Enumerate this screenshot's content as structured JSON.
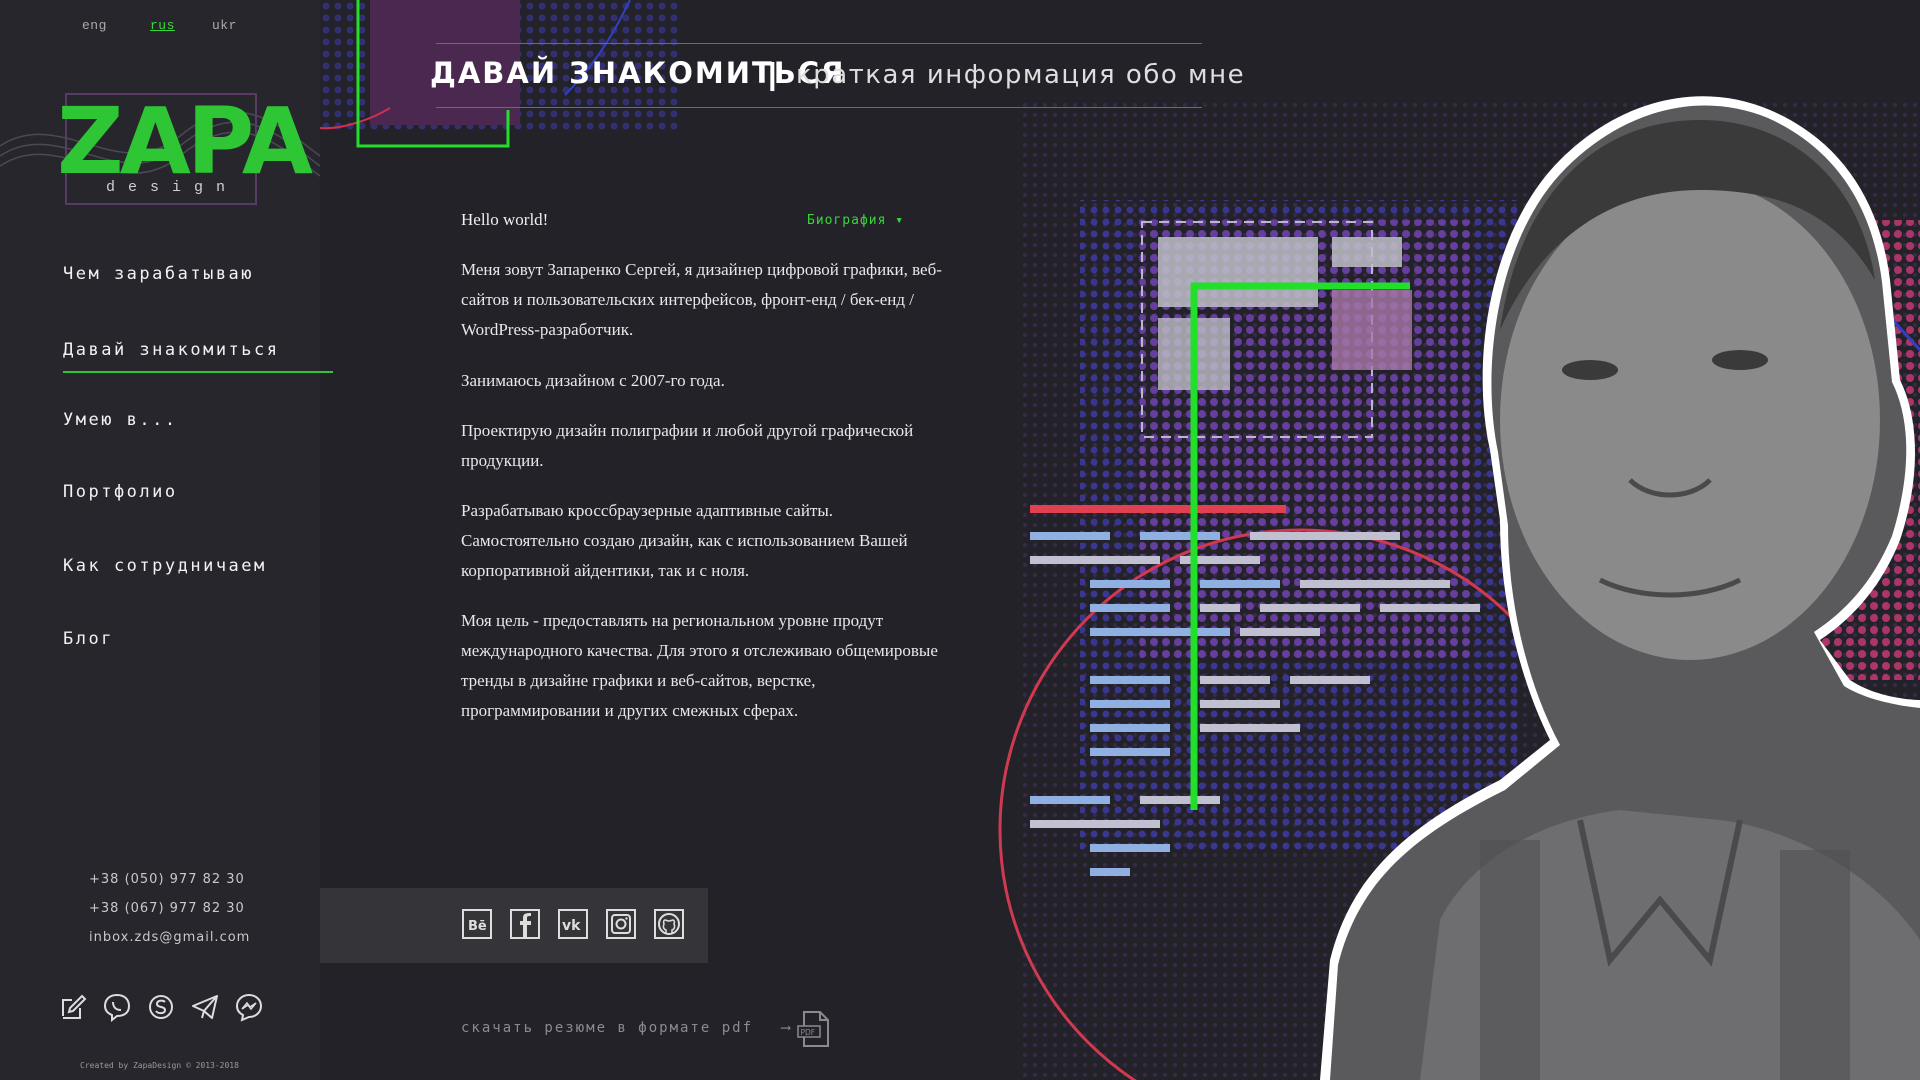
{
  "languages": [
    {
      "code": "eng",
      "active": false
    },
    {
      "code": "rus",
      "active": true
    },
    {
      "code": "ukr",
      "active": false
    }
  ],
  "logo": {
    "main": "ZAPA",
    "sub": "design"
  },
  "nav": [
    {
      "label": "Чем зарабатываю",
      "active": false
    },
    {
      "label": "Давай знакомиться",
      "active": true
    },
    {
      "label": "Умею в...",
      "active": false
    },
    {
      "label": "Портфолио",
      "active": false
    },
    {
      "label": "Как сотрудничаем",
      "active": false
    },
    {
      "label": "Блог",
      "active": false
    }
  ],
  "contacts": {
    "phone1": "+38 (050) 977 82 30",
    "phone2": "+38 (067) 977 82 30",
    "email": "inbox.zds@gmail.com"
  },
  "messengers": [
    "write-icon",
    "viber-icon",
    "skype-icon",
    "telegram-icon",
    "messenger-icon"
  ],
  "credits": "Created by ZapaDesign © 2013-2018",
  "header": {
    "title": "ДАВАЙ ЗНАКОМИТЬСЯ",
    "separator": "|",
    "subtitle": "краткая информация обо мне"
  },
  "content": {
    "hello": "Hello world!",
    "dropdown": "Биография ▾",
    "paragraphs": [
      "Меня зовут Запаренко Сергей, я дизайнер цифровой графики, веб-сайтов и пользовательских интерфейсов, фронт-енд / бек-енд / WordPress-разработчик.",
      "Занимаюсь дизайном с 2007-го года.",
      "Проектирую дизайн полиграфии и любой другой графической продукции.",
      "Разрабатываю кроссбраузерные адаптивные сайты. Самостоятельно создаю дизайн, как с использованием Вашей корпоративной айдентики, так и с ноля.",
      "Моя цель - предоставлять на региональном уровне продут международного качества. Для этого я отслеживаю общемировые тренды в дизайне графики и веб-сайтов, верстке, программировании и других смежных сферах."
    ]
  },
  "social": [
    "behance-icon",
    "facebook-icon",
    "vk-icon",
    "instagram-icon",
    "github-icon"
  ],
  "resume": {
    "label": "скачать резюме в формате pdf",
    "arrow": "⟶",
    "file_label": "PDF"
  },
  "colors": {
    "accent": "#2ec634",
    "background": "#232229",
    "sidebar": "#27262c",
    "pink": "#e0336f",
    "purple": "#6b3fa0"
  }
}
